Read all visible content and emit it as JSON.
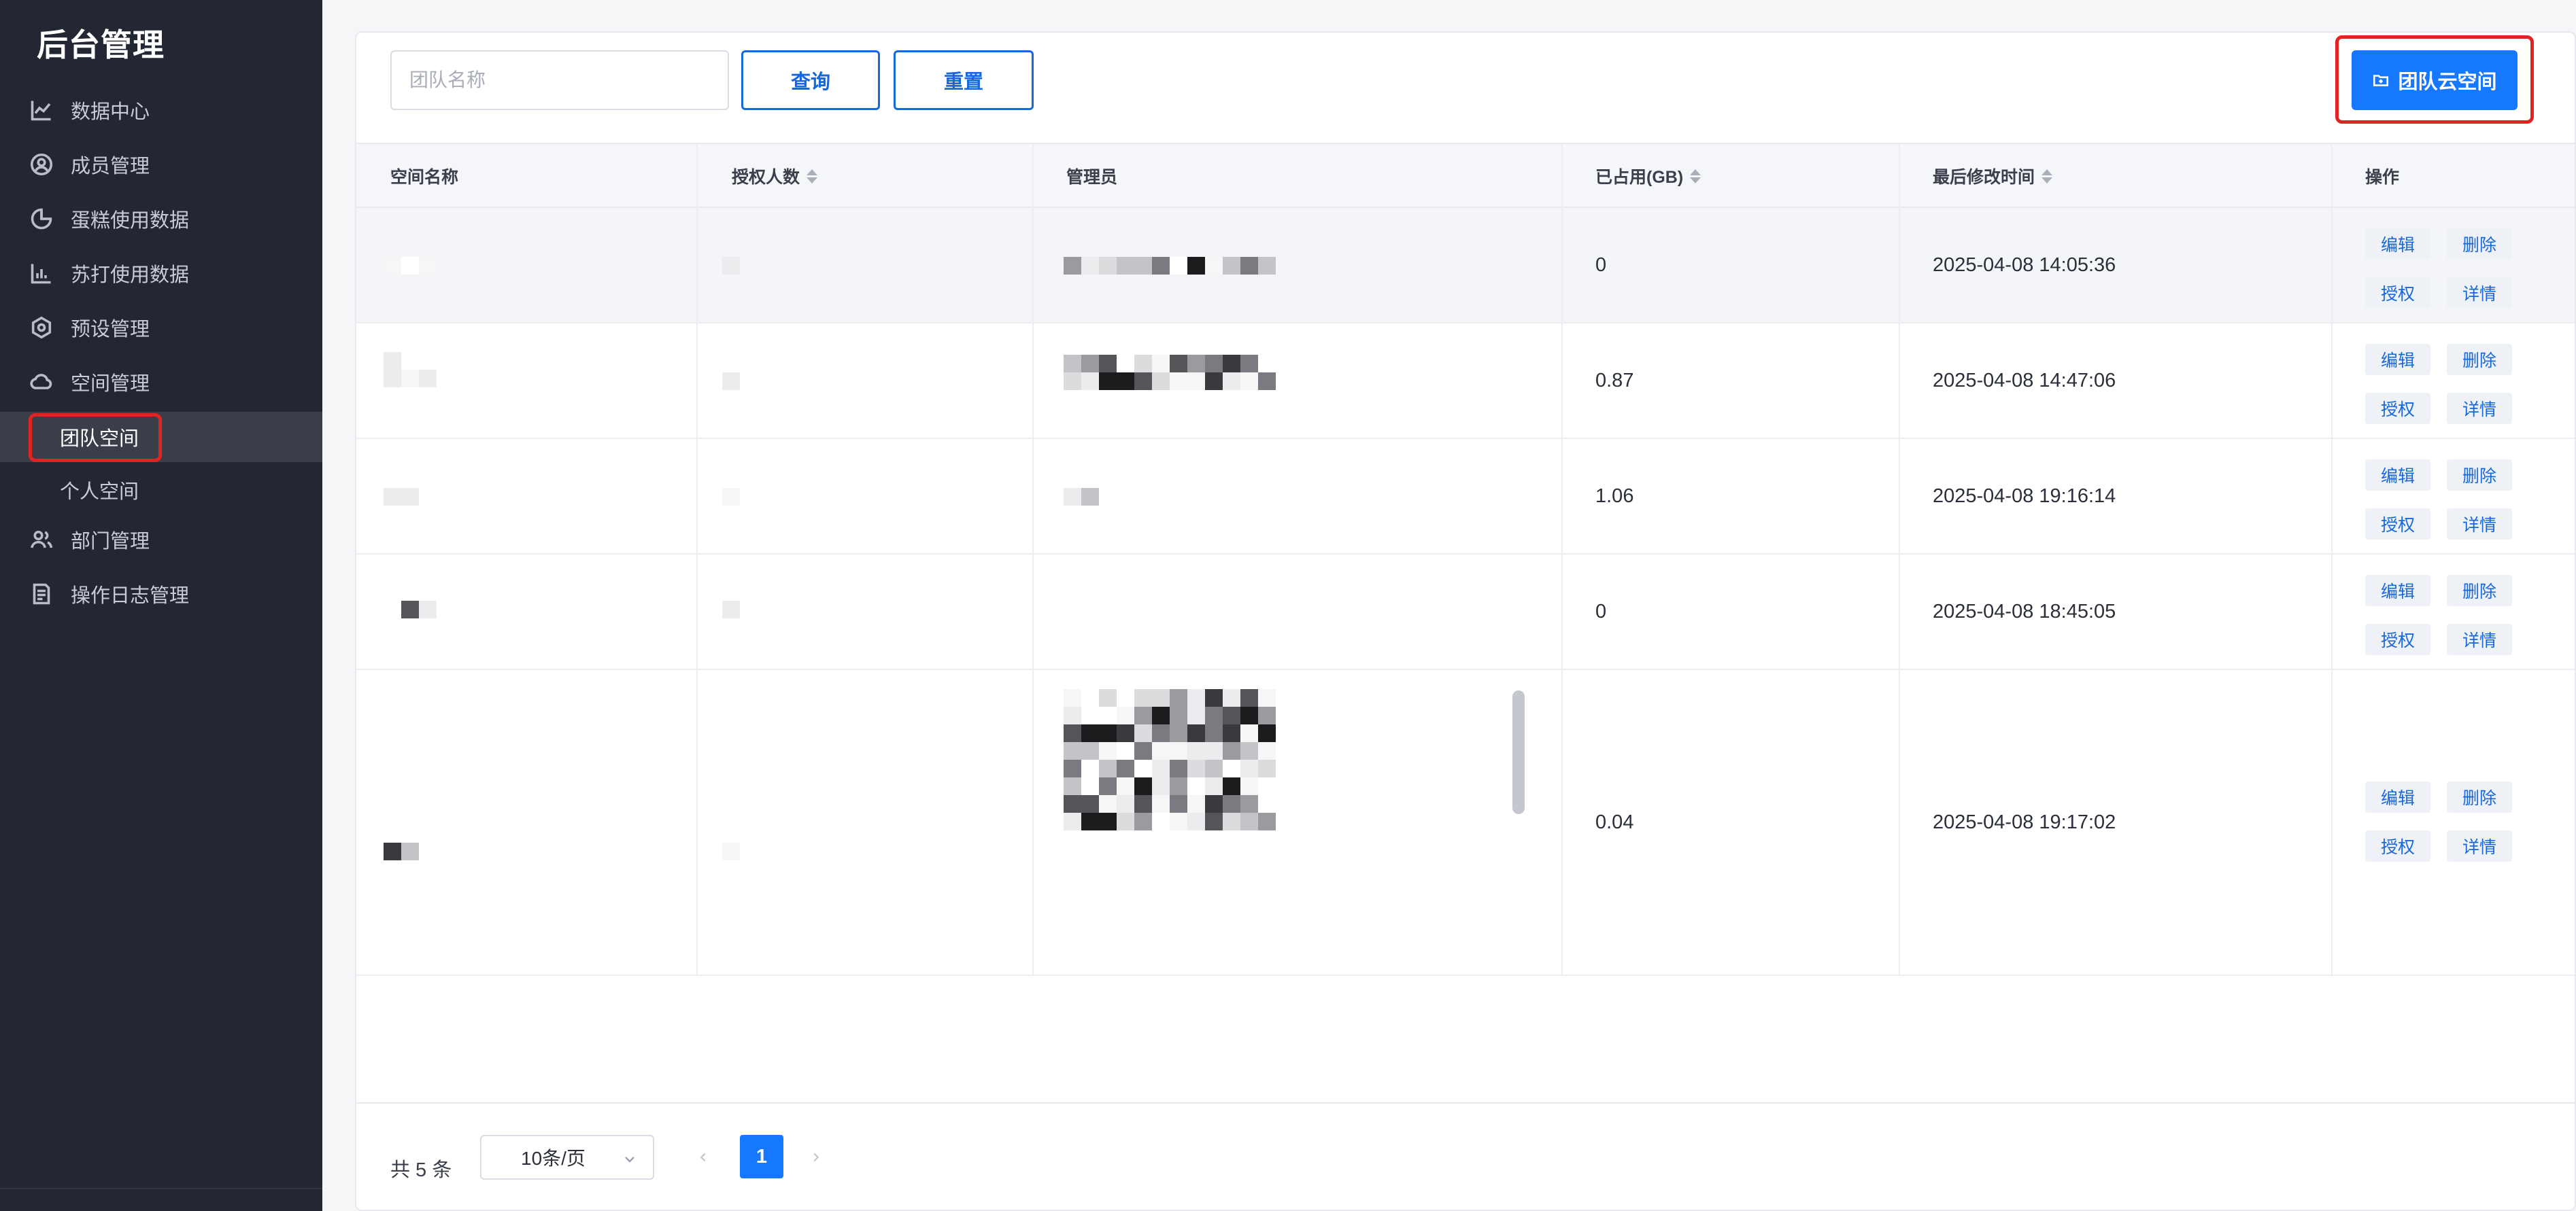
{
  "app": {
    "title": "后台管理"
  },
  "sidebar": {
    "items": [
      {
        "label": "数据中心",
        "icon": "line-chart-icon"
      },
      {
        "label": "成员管理",
        "icon": "user-circle-icon"
      },
      {
        "label": "蛋糕使用数据",
        "icon": "pie-chart-icon"
      },
      {
        "label": "苏打使用数据",
        "icon": "bar-chart-icon"
      },
      {
        "label": "预设管理",
        "icon": "hexagon-settings-icon"
      },
      {
        "label": "空间管理",
        "icon": "cloud-icon"
      },
      {
        "label": "部门管理",
        "icon": "users-icon"
      },
      {
        "label": "操作日志管理",
        "icon": "log-document-icon"
      }
    ],
    "subitems": [
      {
        "label": "团队空间",
        "active": true
      },
      {
        "label": "个人空间",
        "active": false
      }
    ]
  },
  "toolbar": {
    "search_placeholder": "团队名称",
    "query_label": "查询",
    "reset_label": "重置",
    "create_label": "团队云空间",
    "create_icon": "folder-plus-icon"
  },
  "table": {
    "columns": [
      "空间名称",
      "授权人数",
      "管理员",
      "已占用(GB)",
      "最后修改时间",
      "操作"
    ],
    "rows": [
      {
        "used": "0",
        "modified": "2025-04-08 14:05:36"
      },
      {
        "used": "0.87",
        "modified": "2025-04-08 14:47:06"
      },
      {
        "used": "1.06",
        "modified": "2025-04-08 19:16:14"
      },
      {
        "used": "0",
        "modified": "2025-04-08 18:45:05"
      },
      {
        "used": "0.04",
        "modified": "2025-04-08 19:17:02"
      }
    ],
    "actions": {
      "edit": "编辑",
      "delete": "删除",
      "authorize": "授权",
      "detail": "详情"
    }
  },
  "pagination": {
    "total_text": "共 5 条",
    "page_size": "10条/页",
    "current_page": "1"
  },
  "colors": {
    "primary": "#1677ff",
    "sidebar_bg": "#232733",
    "highlight": "#e02424"
  }
}
